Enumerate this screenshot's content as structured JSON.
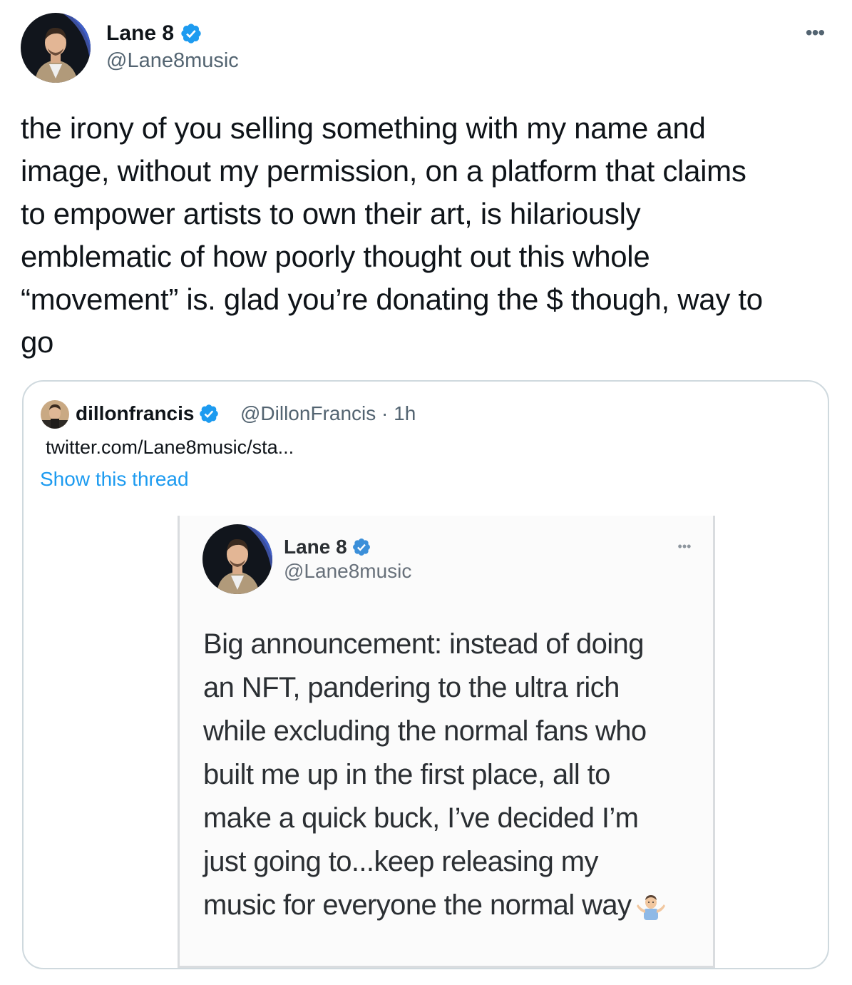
{
  "tweet": {
    "author": {
      "display_name": "Lane 8",
      "handle": "@Lane8music",
      "verified": true
    },
    "more_menu_icon": "more-horizontal-icon",
    "text_lines": [
      "the irony of you selling something with my name and",
      "image, without my permission, on a platform that claims",
      "to empower artists to own their art, is hilariously",
      "emblematic of how poorly thought out this whole",
      "“movement” is. glad you’re donating the $ though, way to",
      "go"
    ]
  },
  "quoted_tweet": {
    "author": {
      "display_name": "dillonfrancis",
      "handle_time": "@DillonFrancis · 1h",
      "verified": true
    },
    "link_text": "twitter.com/Lane8music/sta...",
    "show_thread": "Show this thread",
    "screenshot": {
      "display_name": "Lane 8",
      "handle": "@Lane8music",
      "verified": true,
      "more_menu_icon": "more-horizontal-icon",
      "text_lines": [
        "Big announcement: instead of doing",
        "an NFT, pandering to the ultra rich",
        "while excluding the normal fans who",
        "built me up in the first place, all to",
        "make a quick buck, I’ve decided I’m",
        "just going to...keep releasing my",
        "music for everyone the normal way"
      ],
      "trailing_emoji": "person-shrugging-emoji"
    }
  },
  "colors": {
    "text": "#0f1419",
    "secondary_text": "#536471",
    "link_blue": "#1d9bf0",
    "verified_blue": "#1d9bf0",
    "card_border": "#cfd9de"
  }
}
